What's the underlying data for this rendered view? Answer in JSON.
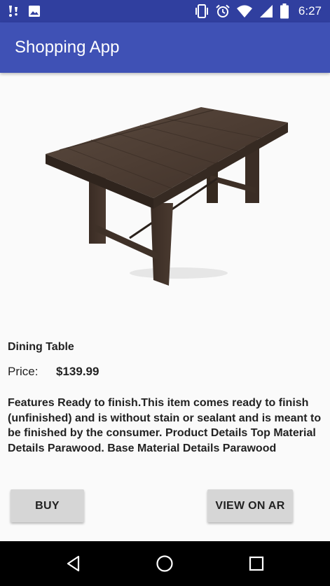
{
  "status_bar": {
    "time": "6:27",
    "left_icons": [
      "notification-icon",
      "image-icon"
    ],
    "right_icons": [
      "vibrate-icon",
      "alarm-icon",
      "wifi-icon",
      "signal-icon",
      "battery-icon"
    ]
  },
  "app_bar": {
    "title": "Shopping App"
  },
  "product": {
    "image": "dining-table-image",
    "name": "Dining Table",
    "price_label": "Price:",
    "price_value": "$139.99",
    "description": "Features Ready to finish.This item comes ready to finish (unfinished) and is without stain or sealant and is meant to be finished by the consumer. Product Details Top Material Details Parawood. Base Material Details Parawood"
  },
  "actions": {
    "buy_label": "BUY",
    "ar_label": "VIEW ON AR"
  },
  "nav_bar": {
    "buttons": [
      "back-icon",
      "home-icon",
      "recents-icon"
    ]
  },
  "colors": {
    "status_bar": "#303f9f",
    "app_bar": "#3f51b5",
    "background": "#fafafa",
    "button": "#d6d6d6",
    "nav_bar": "#000000"
  }
}
